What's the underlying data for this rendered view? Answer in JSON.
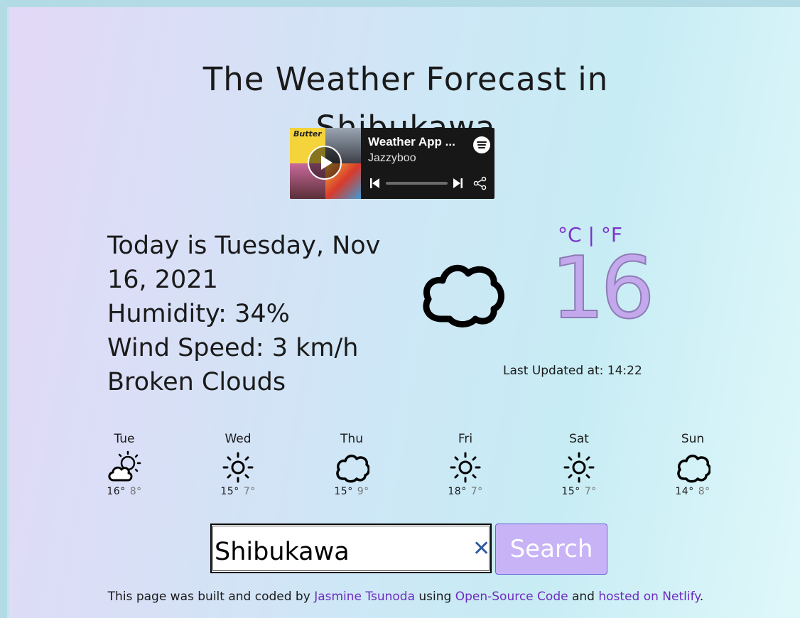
{
  "title_line1": "The Weather Forecast in",
  "title_line2": "Shibukawa",
  "spotify": {
    "track": "Weather App ...",
    "artist": "Jazzyboo",
    "cover_text": "Butter"
  },
  "today": {
    "date_line": "Today is Tuesday, Nov 16, 2021",
    "humidity": "Humidity: 34%",
    "wind": "Wind Speed: 3 km/h",
    "description": "Broken Clouds",
    "icon": "cloud-icon",
    "temperature": "16",
    "unit_c": "°C",
    "unit_sep": "|",
    "unit_f": "°F",
    "last_updated": "Last Updated at: 14:22"
  },
  "forecast": [
    {
      "day": "Tue",
      "icon": "partly-cloudy-icon",
      "max": "16°",
      "min": "8°"
    },
    {
      "day": "Wed",
      "icon": "sun-icon",
      "max": "15°",
      "min": "7°"
    },
    {
      "day": "Thu",
      "icon": "cloud-icon",
      "max": "15°",
      "min": "9°"
    },
    {
      "day": "Fri",
      "icon": "sun-icon",
      "max": "18°",
      "min": "7°"
    },
    {
      "day": "Sat",
      "icon": "sun-icon",
      "max": "15°",
      "min": "7°"
    },
    {
      "day": "Sun",
      "icon": "cloud-icon",
      "max": "14°",
      "min": "8°"
    }
  ],
  "search": {
    "value": "Shibukawa",
    "button_label": "Search",
    "clear_glyph": "✕"
  },
  "footer": {
    "prefix": "This page was built and coded by",
    "author": "Jasmine Tsunoda",
    "mid": "using",
    "source": "Open-Source Code",
    "and": "and",
    "hosted": "hosted on Netlify",
    "end": "."
  },
  "colors": {
    "accent_purple": "#7a34c9",
    "temp_lilac": "#c3a9ec",
    "button_lilac": "#c7b3f6"
  }
}
